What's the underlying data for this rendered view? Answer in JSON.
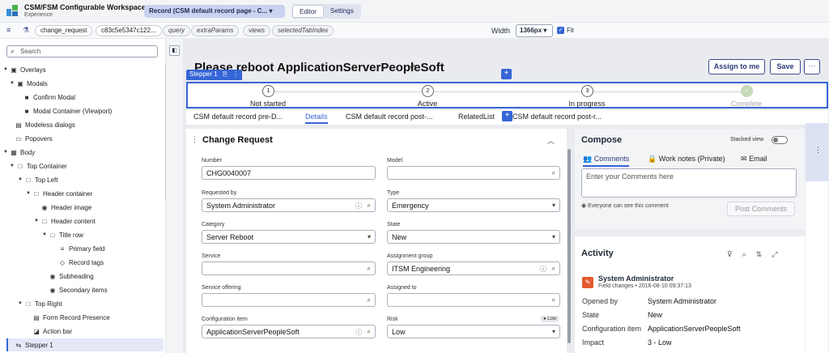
{
  "app": {
    "title": "CSM/FSM Configurable Workspace",
    "subtitle": "Experience",
    "page_selector": "Record (CSM default record page - C...",
    "mode_editor": "Editor",
    "mode_settings": "Settings"
  },
  "params": {
    "chips": [
      "change_request",
      "c83c5e5347c122...",
      "query",
      "extraParams",
      "views",
      "selectedTabIndex"
    ],
    "width_label": "Width",
    "width_value": "1366px",
    "fit_label": "Fit"
  },
  "sidebar": {
    "search_placeholder": "Search",
    "items": [
      {
        "label": "Overlays"
      },
      {
        "label": "Modals"
      },
      {
        "label": "Confirm Modal"
      },
      {
        "label": "Modal Container (Viewport)"
      },
      {
        "label": "Modeless dialogs"
      },
      {
        "label": "Popovers"
      },
      {
        "label": "Body"
      },
      {
        "label": "Top Container"
      },
      {
        "label": "Top Left"
      },
      {
        "label": "Header container"
      },
      {
        "label": "Header image"
      },
      {
        "label": "Header content"
      },
      {
        "label": "Title row"
      },
      {
        "label": "Primary field"
      },
      {
        "label": "Record tags"
      },
      {
        "label": "Subheading"
      },
      {
        "label": "Secondary items"
      },
      {
        "label": "Top Right"
      },
      {
        "label": "Form Record Presence"
      },
      {
        "label": "Action bar"
      },
      {
        "label": "Stepper 1"
      }
    ]
  },
  "record": {
    "title": "Please reboot ApplicationServerPeopleSoft",
    "assign_btn": "Assign to me",
    "save_btn": "Save",
    "more_btn": "···"
  },
  "stepper": {
    "tag_label": "Stepper 1",
    "steps": [
      {
        "num": "1",
        "label": "Not started"
      },
      {
        "num": "2",
        "label": "Active"
      },
      {
        "num": "3",
        "label": "In progress"
      },
      {
        "num": "✓",
        "label": "Complete"
      }
    ]
  },
  "tabs": [
    "CSM default record pre-D...",
    "Details",
    "CSM default record post-...",
    "RelatedList",
    "CSM default record post-r..."
  ],
  "form": {
    "title": "Change Request",
    "fields": {
      "number_label": "Number",
      "number_value": "CHG0040007",
      "model_label": "Model",
      "model_value": "",
      "requested_by_label": "Requested by",
      "requested_by_value": "System Administrator",
      "type_label": "Type",
      "type_value": "Emergency",
      "category_label": "Category",
      "category_value": "Server Reboot",
      "state_label": "State",
      "state_value": "New",
      "service_label": "Service",
      "service_value": "",
      "assignment_group_label": "Assignment group",
      "assignment_group_value": "ITSM Engineering",
      "service_offering_label": "Service offering",
      "service_offering_value": "",
      "assigned_to_label": "Assigned to",
      "assigned_to_value": "",
      "config_item_label": "Configuration item",
      "config_item_value": "ApplicationServerPeopleSoft",
      "risk_label": "Risk",
      "risk_value": "Low",
      "risk_badge": "● Low"
    }
  },
  "compose": {
    "title": "Compose",
    "stacked_label": "Stacked view",
    "tab_comments": "Comments",
    "tab_worknotes": "Work notes (Private)",
    "tab_email": "Email",
    "placeholder": "Enter your Comments here",
    "visibility_note": "Everyone can see this comment",
    "post_btn": "Post Comments"
  },
  "activity": {
    "title": "Activity",
    "user": "System Administrator",
    "meta": "Field changes • 2016-08-10 09:37:13",
    "rows": [
      {
        "k": "Opened by",
        "v": "System Administrator"
      },
      {
        "k": "State",
        "v": "New"
      },
      {
        "k": "Configuration item",
        "v": "ApplicationServerPeopleSoft"
      },
      {
        "k": "Impact",
        "v": "3 - Low"
      }
    ]
  },
  "colors": {
    "accent": "#3565d6",
    "brand_nav": "#c9d3ef",
    "activity_avatar": "#e2592f"
  }
}
